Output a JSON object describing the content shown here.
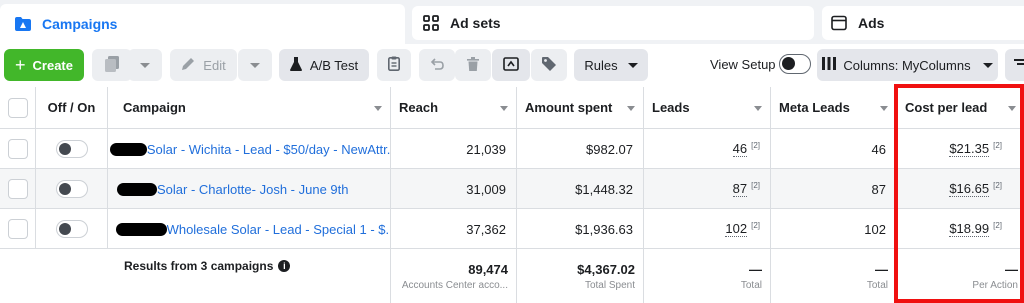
{
  "tabs": [
    {
      "label": "Campaigns",
      "icon": "campaign-folder-icon"
    },
    {
      "label": "Ad sets",
      "icon": "grid-icon"
    },
    {
      "label": "Ads",
      "icon": "window-icon"
    }
  ],
  "toolbar": {
    "create_label": "Create",
    "edit_label": "Edit",
    "ab_test_label": "A/B Test",
    "rules_label": "Rules",
    "view_setup_label": "View Setup",
    "columns_label": "Columns: MyColumns"
  },
  "table": {
    "headers": [
      "Off / On",
      "Campaign",
      "Reach",
      "Amount spent",
      "Leads",
      "Meta Leads",
      "Cost per lead"
    ],
    "rows": [
      {
        "campaign": "Solar - Wichita - Lead - $50/day - NewAttr...",
        "reach": "21,039",
        "amount_spent": "$982.07",
        "leads": "46",
        "leads_sup": "[2]",
        "meta_leads": "46",
        "cost_per_lead": "$21.35",
        "cpl_sup": "[2]"
      },
      {
        "campaign": "Solar - Charlotte- Josh - June 9th",
        "reach": "31,009",
        "amount_spent": "$1,448.32",
        "leads": "87",
        "leads_sup": "[2]",
        "meta_leads": "87",
        "cost_per_lead": "$16.65",
        "cpl_sup": "[2]"
      },
      {
        "campaign": "Wholesale Solar - Lead - Special 1 - $...",
        "reach": "37,362",
        "amount_spent": "$1,936.63",
        "leads": "102",
        "leads_sup": "[2]",
        "meta_leads": "102",
        "cost_per_lead": "$18.99",
        "cpl_sup": "[2]"
      }
    ],
    "summary": {
      "label": "Results from 3 campaigns",
      "reach": "89,474",
      "reach_sub": "Accounts Center acco...",
      "amount_spent": "$4,367.02",
      "amount_spent_sub": "Total Spent",
      "leads": "—",
      "leads_sub": "Total",
      "meta_leads": "—",
      "meta_leads_sub": "Total",
      "cost_per_lead": "—",
      "cost_per_lead_sub": "Per Action"
    }
  },
  "colors": {
    "accent": "#1877f2",
    "create_green": "#42b72a",
    "highlight_red": "#f01010",
    "link": "#216fdb"
  }
}
